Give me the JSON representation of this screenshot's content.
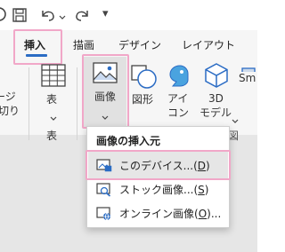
{
  "qat": {
    "customize_glyph": "▾"
  },
  "tabs": {
    "insert": "挿入",
    "draw": "描画",
    "design": "デザイン",
    "layout": "レイアウト"
  },
  "ribbon": {
    "partial_page_line1": "ージ",
    "partial_page_line2": "切り",
    "table_label": "表",
    "table_group_label": "表",
    "picture_label": "画像",
    "shapes_label": "図形",
    "icons_line1": "アイ",
    "icons_line2": "コン",
    "models_line1": "3D",
    "models_line2": "モデル",
    "smartart_label": "Sm",
    "group_partial_char": "図",
    "dropdown_glyph": "⌄"
  },
  "menu": {
    "header": "画像の挿入元",
    "items": [
      {
        "label": "このデバイス...(",
        "key": "D",
        "suffix": ")",
        "icon": "device-icon"
      },
      {
        "label": "ストック画像...(",
        "key": "S",
        "suffix": ")",
        "icon": "stock-images-icon"
      },
      {
        "label": "オンライン画像(",
        "key": "O",
        "suffix": ")...",
        "icon": "online-pictures-icon"
      }
    ]
  },
  "colors": {
    "highlight": "#f1a7c8",
    "accent_blue": "#2b6cc4",
    "ribbon_bg": "#f6f6f6",
    "hover_bg": "#e1e1e1"
  }
}
